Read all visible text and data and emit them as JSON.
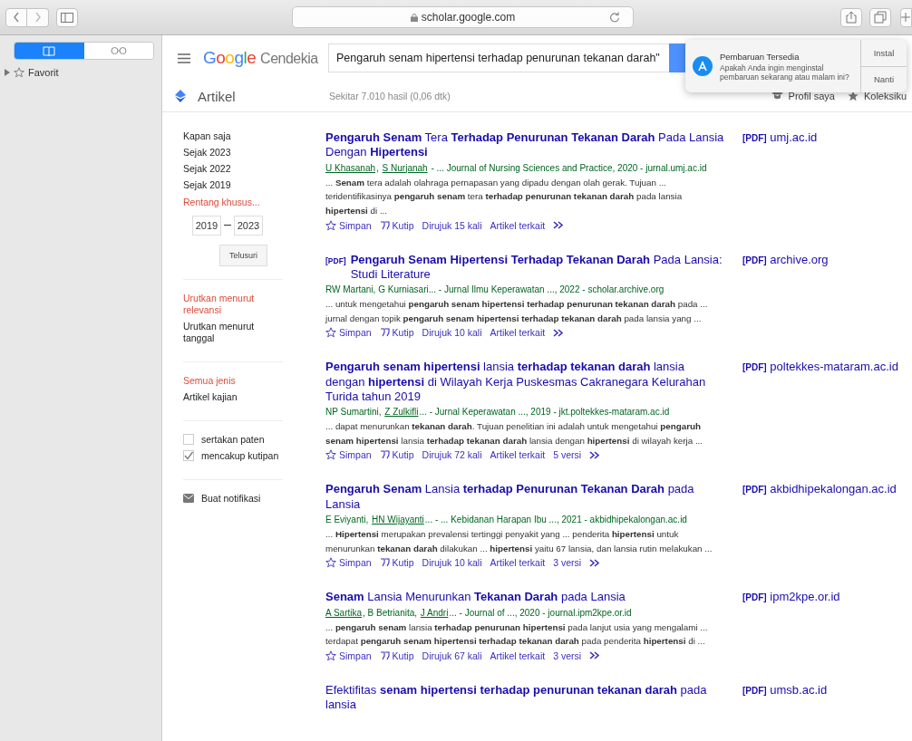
{
  "browser": {
    "address": "scholar.google.com"
  },
  "sidebar": {
    "tabs": [
      {
        "kind": "bookmarks",
        "selected": true
      },
      {
        "kind": "reading",
        "selected": false
      }
    ],
    "items": [
      {
        "label": "Favorit",
        "expanded": false
      }
    ]
  },
  "header": {
    "logo": "Google",
    "product": "Cendekia",
    "search": {
      "value": "Pengaruh senam hipertensi terhadap penurunan tekanan darah\""
    }
  },
  "notification": {
    "title": "Pembaruan Tersedia",
    "message": "Apakah Anda ingin menginstal pembaruan sekarang atau malam ini?",
    "buttons": [
      "Instal",
      "Nanti"
    ]
  },
  "subheader": {
    "section": "Artikel",
    "stats": "Sekitar 7.010 hasil (0,06 dtk)",
    "links": [
      {
        "label": "Profil saya",
        "kind": "profile"
      },
      {
        "label": "Koleksiku",
        "kind": "star"
      }
    ]
  },
  "filters": [
    {
      "items": [
        {
          "label": "Kapan saja",
          "selected": false
        },
        {
          "label": "Sejak 2023",
          "selected": false
        },
        {
          "label": "Sejak 2022",
          "selected": false
        },
        {
          "label": "Sejak 2019",
          "selected": false
        },
        {
          "label": "Rentang khusus...",
          "selected": true
        }
      ],
      "range": {
        "from": "2019",
        "to": "2023",
        "button": "Telusuri"
      }
    },
    {
      "items": [
        {
          "label": "Urutkan menurut relevansi",
          "selected": true
        },
        {
          "label": "Urutkan menurut tanggal",
          "selected": false
        }
      ]
    },
    {
      "items": [
        {
          "label": "Semua jenis",
          "selected": true
        },
        {
          "label": "Artikel kajian",
          "selected": false
        }
      ]
    },
    {
      "checkboxes": [
        {
          "label": "sertakan paten",
          "checked": false
        },
        {
          "label": "mencakup kutipan",
          "checked": true
        }
      ]
    },
    {
      "alert": "Buat notifikasi"
    }
  ],
  "results": [
    {
      "title": "**Pengaruh Senam** Tera **Terhadap Penurunan Tekanan Darah** Pada Lansia Dengan **Hipertensi**",
      "byline": [
        {
          "text": "U Khasanah",
          "linked": true
        },
        {
          "text": ", ",
          "linked": false
        },
        {
          "text": "S Nurjanah",
          "linked": true
        },
        {
          "text": " - ... Journal of Nursing Sciences and Practice, 2020 - jurnal.umj.ac.id",
          "linked": false
        }
      ],
      "snippet": "... **Senam** tera adalah olahraga pernapasan yang dipadu dengan olah gerak. Tujuan ... teridentifikasinya **pengaruh senam** tera **terhadap penurunan tekanan darah** pada lansia **hipertensi** di ...",
      "actions": [
        {
          "label": "Simpan",
          "kind": "save"
        },
        {
          "label": "Kutip",
          "kind": "cite"
        },
        {
          "label": "Dirujuk 15 kali",
          "kind": "link"
        },
        {
          "label": "Artikel terkait",
          "kind": "link"
        }
      ],
      "pdf": {
        "tag": "[PDF]",
        "domain": "umj.ac.id"
      }
    },
    {
      "title_tag": "[PDF]",
      "title": "**Pengaruh Senam Hipertensi Terhadap Tekanan Darah** Pada Lansia: Studi Literature",
      "byline": [
        {
          "text": "RW Martani, G Kurniasari... - Jurnal Ilmu Keperawatan ..., 2022 - scholar.archive.org",
          "linked": false
        }
      ],
      "snippet": "... untuk mengetahui **pengaruh senam hipertensi terhadap penurunan tekanan darah** pada ... jurnal dengan topik **pengaruh senam hipertensi terhadap tekanan darah** pada lansia yang ...",
      "actions": [
        {
          "label": "Simpan",
          "kind": "save"
        },
        {
          "label": "Kutip",
          "kind": "cite"
        },
        {
          "label": "Dirujuk 10 kali",
          "kind": "link"
        },
        {
          "label": "Artikel terkait",
          "kind": "link"
        }
      ],
      "pdf": {
        "tag": "[PDF]",
        "domain": "archive.org"
      }
    },
    {
      "title": "**Pengaruh senam hipertensi** lansia **terhadap tekanan darah** lansia dengan **hipertensi** di Wilayah Kerja Puskesmas Cakranegara Kelurahan Turida tahun 2019",
      "byline": [
        {
          "text": "NP Sumartini, ",
          "linked": false
        },
        {
          "text": "Z Zulkifli",
          "linked": true
        },
        {
          "text": "... - Jurnal Keperawatan ..., 2019 - jkt.poltekkes-mataram.ac.id",
          "linked": false
        }
      ],
      "snippet": "... dapat menurunkan **tekanan darah**. Tujuan penelitian ini adalah untuk mengetahui **pengaruh senam hipertensi** lansia **terhadap tekanan darah** lansia dengan **hipertensi** di wilayah kerja ...",
      "actions": [
        {
          "label": "Simpan",
          "kind": "save"
        },
        {
          "label": "Kutip",
          "kind": "cite"
        },
        {
          "label": "Dirujuk 72 kali",
          "kind": "link"
        },
        {
          "label": "Artikel terkait",
          "kind": "link"
        },
        {
          "label": "5 versi",
          "kind": "link"
        }
      ],
      "pdf": {
        "tag": "[PDF]",
        "domain": "poltekkes-mataram.ac.id"
      }
    },
    {
      "title": "**Pengaruh Senam** Lansia **terhadap Penurunan Tekanan Darah** pada Lansia",
      "byline": [
        {
          "text": "E Eviyanti, ",
          "linked": false
        },
        {
          "text": "HN Wijayanti",
          "linked": true
        },
        {
          "text": "... - ... Kebidanan Harapan Ibu ..., 2021 - akbidhipekalongan.ac.id",
          "linked": false
        }
      ],
      "snippet": "... **Hipertensi** merupakan prevalensi tertinggi penyakit yang ... penderita **hipertensi** untuk menurunkan **tekanan darah** dilakukan ... **hipertensi** yaitu 67 lansia, dan lansia rutin melakukan ...",
      "actions": [
        {
          "label": "Simpan",
          "kind": "save"
        },
        {
          "label": "Kutip",
          "kind": "cite"
        },
        {
          "label": "Dirujuk 10 kali",
          "kind": "link"
        },
        {
          "label": "Artikel terkait",
          "kind": "link"
        },
        {
          "label": "3 versi",
          "kind": "link"
        }
      ],
      "pdf": {
        "tag": "[PDF]",
        "domain": "akbidhipekalongan.ac.id"
      }
    },
    {
      "title": "**Senam** Lansia Menurunkan **Tekanan Darah** pada Lansia",
      "byline": [
        {
          "text": "A Sartika",
          "linked": true
        },
        {
          "text": ", B Betrianita, ",
          "linked": false
        },
        {
          "text": "J Andri",
          "linked": true
        },
        {
          "text": "... - Journal of ..., 2020 - journal.ipm2kpe.or.id",
          "linked": false
        }
      ],
      "snippet": "... **pengaruh senam** lansia **terhadap penurunan hipertensi** pada lanjut usia yang mengalami ... terdapat **pengaruh senam hipertensi terhadap tekanan darah** pada penderita **hipertensi** di ...",
      "actions": [
        {
          "label": "Simpan",
          "kind": "save"
        },
        {
          "label": "Kutip",
          "kind": "cite"
        },
        {
          "label": "Dirujuk 67 kali",
          "kind": "link"
        },
        {
          "label": "Artikel terkait",
          "kind": "link"
        },
        {
          "label": "3 versi",
          "kind": "link"
        }
      ],
      "pdf": {
        "tag": "[PDF]",
        "domain": "ipm2kpe.or.id"
      }
    },
    {
      "title": "Efektifitas **senam hipertensi terhadap penurunan tekanan darah** pada lansia",
      "pdf": {
        "tag": "[PDF]",
        "domain": "umsb.ac.id"
      }
    }
  ]
}
